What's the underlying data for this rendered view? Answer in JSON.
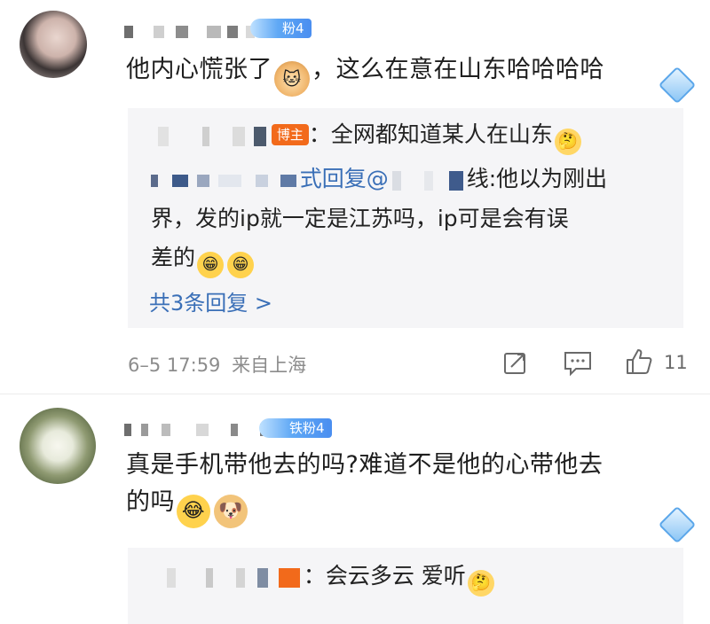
{
  "comments": [
    {
      "fan_badge": "粉4",
      "text": "他内心慌张了",
      "text_tail": "，这么在意在山东哈哈哈哈",
      "replies_panel": {
        "host_reply": {
          "badge": "博主",
          "text": "：全网都知道某人在山东"
        },
        "sub_reply": {
          "prefix": "式回复@",
          "suffix": "线:他以为刚出",
          "line2": "界，发的ip就一定是江苏吗，ip可是会有误",
          "line3": "差的"
        },
        "more_link": "共3条回复 >"
      },
      "meta": {
        "timestamp": "6–5 17:59",
        "source": "来自上海",
        "like_count": "11"
      }
    },
    {
      "fan_badge": "铁粉4",
      "text_line1": "真是手机带他去的吗?难道不是他的心带他去",
      "text_line2": "的吗",
      "reply": {
        "text": "：会云多云 爱听"
      }
    }
  ],
  "icons": {
    "share": "share-icon",
    "comment": "comment-icon",
    "like": "thumbs-up-icon"
  },
  "colors": {
    "link": "#3a6fb7",
    "host_badge": "#f26a1b",
    "fan_badge": "#4a8ef0",
    "panel_bg": "#f5f5f7",
    "meta_text": "#8c8c8c"
  }
}
